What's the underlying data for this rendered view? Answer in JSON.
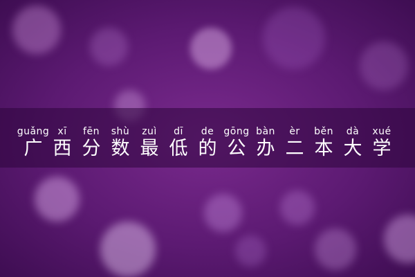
{
  "title": {
    "chars": [
      {
        "pinyin": "guǎng",
        "hanzi": "广"
      },
      {
        "pinyin": "xī",
        "hanzi": "西"
      },
      {
        "pinyin": "fēn",
        "hanzi": "分"
      },
      {
        "pinyin": "shù",
        "hanzi": "数"
      },
      {
        "pinyin": "zuì",
        "hanzi": "最"
      },
      {
        "pinyin": "dī",
        "hanzi": "低"
      },
      {
        "pinyin": "de",
        "hanzi": "的"
      },
      {
        "pinyin": "gōng",
        "hanzi": "公"
      },
      {
        "pinyin": "bàn",
        "hanzi": "办"
      },
      {
        "pinyin": "èr",
        "hanzi": "二"
      },
      {
        "pinyin": "běn",
        "hanzi": "本"
      },
      {
        "pinyin": "dà",
        "hanzi": "大"
      },
      {
        "pinyin": "xué",
        "hanzi": "学"
      }
    ]
  },
  "colors": {
    "background": "#5c1a72",
    "text": "#ffffff"
  }
}
